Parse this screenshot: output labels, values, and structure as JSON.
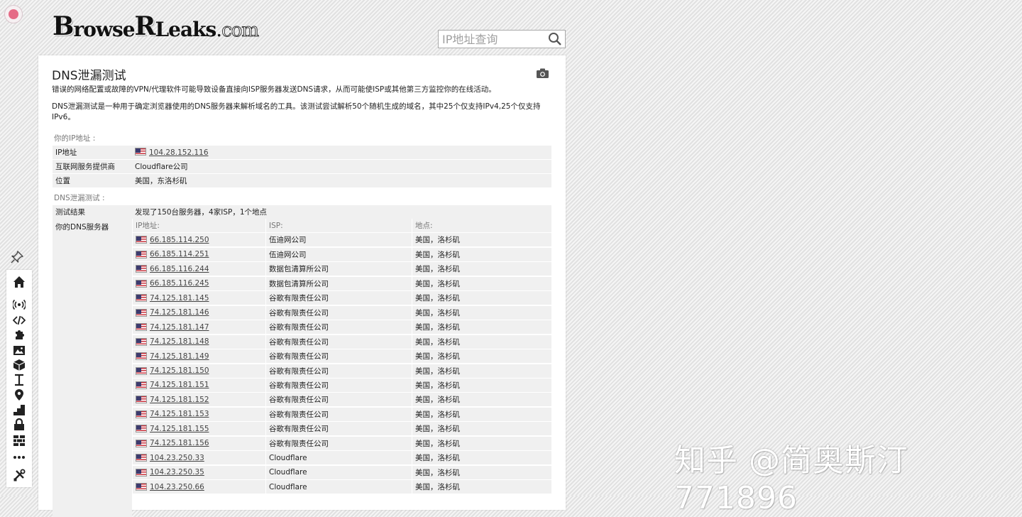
{
  "header": {
    "logo_text": "BrowserLeaks.com",
    "search_placeholder": "IP地址查询"
  },
  "page": {
    "title": "DNS泄漏测试",
    "description_1": "错误的网络配置或故障的VPN/代理软件可能导致设备直接向ISP服务器发送DNS请求，从而可能使ISP或其他第三方监控你的在线活动。",
    "description_2": "DNS泄漏测试是一种用于确定浏览器使用的DNS服务器来解析域名的工具。该测试尝试解析50个随机生成的域名，其中25个仅支持IPv4,25个仅支持IPv6。"
  },
  "ip_section": {
    "heading": "你的IP地址 :",
    "rows": [
      {
        "key": "IP地址",
        "value": "104.28.152.116"
      },
      {
        "key": "互联网服务提供商",
        "value": "Cloudflare公司"
      },
      {
        "key": "位置",
        "value": "美国，东洛杉矶"
      }
    ]
  },
  "dns_section": {
    "heading": "DNS泄漏测试 :",
    "result_key": "测试结果",
    "result_value": "发现了150台服务器，4家ISP，1个地点",
    "servers_key": "你的DNS服务器",
    "columns": [
      "IP地址:",
      "ISP:",
      "地点:"
    ],
    "servers": [
      {
        "ip": "66.185.114.250",
        "isp": "伍迪网公司",
        "location": "美国，洛杉矶"
      },
      {
        "ip": "66.185.114.251",
        "isp": "伍迪网公司",
        "location": "美国，洛杉矶"
      },
      {
        "ip": "66.185.116.244",
        "isp": "数据包清算所公司",
        "location": "美国，洛杉矶"
      },
      {
        "ip": "66.185.116.245",
        "isp": "数据包清算所公司",
        "location": "美国，洛杉矶"
      },
      {
        "ip": "74.125.181.145",
        "isp": "谷歌有限责任公司",
        "location": "美国，洛杉矶"
      },
      {
        "ip": "74.125.181.146",
        "isp": "谷歌有限责任公司",
        "location": "美国，洛杉矶"
      },
      {
        "ip": "74.125.181.147",
        "isp": "谷歌有限责任公司",
        "location": "美国，洛杉矶"
      },
      {
        "ip": "74.125.181.148",
        "isp": "谷歌有限责任公司",
        "location": "美国，洛杉矶"
      },
      {
        "ip": "74.125.181.149",
        "isp": "谷歌有限责任公司",
        "location": "美国，洛杉矶"
      },
      {
        "ip": "74.125.181.150",
        "isp": "谷歌有限责任公司",
        "location": "美国，洛杉矶"
      },
      {
        "ip": "74.125.181.151",
        "isp": "谷歌有限责任公司",
        "location": "美国，洛杉矶"
      },
      {
        "ip": "74.125.181.152",
        "isp": "谷歌有限责任公司",
        "location": "美国，洛杉矶"
      },
      {
        "ip": "74.125.181.153",
        "isp": "谷歌有限责任公司",
        "location": "美国，洛杉矶"
      },
      {
        "ip": "74.125.181.155",
        "isp": "谷歌有限责任公司",
        "location": "美国，洛杉矶"
      },
      {
        "ip": "74.125.181.156",
        "isp": "谷歌有限责任公司",
        "location": "美国，洛杉矶"
      },
      {
        "ip": "104.23.250.33",
        "isp": "Cloudflare",
        "location": "美国，洛杉矶"
      },
      {
        "ip": "104.23.250.35",
        "isp": "Cloudflare",
        "location": "美国，洛杉矶"
      },
      {
        "ip": "104.23.250.66",
        "isp": "Cloudflare",
        "location": "美国，洛杉矶"
      }
    ]
  },
  "sidebar_icons": [
    "home-icon",
    "wifi-broadcast-icon",
    "code-icon",
    "puzzle-icon",
    "image-icon",
    "cube-icon",
    "text-cursor-icon",
    "location-pin-icon",
    "stairs-icon",
    "lock-icon",
    "bricks-icon",
    "more-dots-icon",
    "tools-icon"
  ],
  "watermark": "知乎 @简奥斯汀771896",
  "colors": {
    "row_bg": "#f0f0f0",
    "card_bg": "#ffffff",
    "muted_text": "#777777"
  }
}
